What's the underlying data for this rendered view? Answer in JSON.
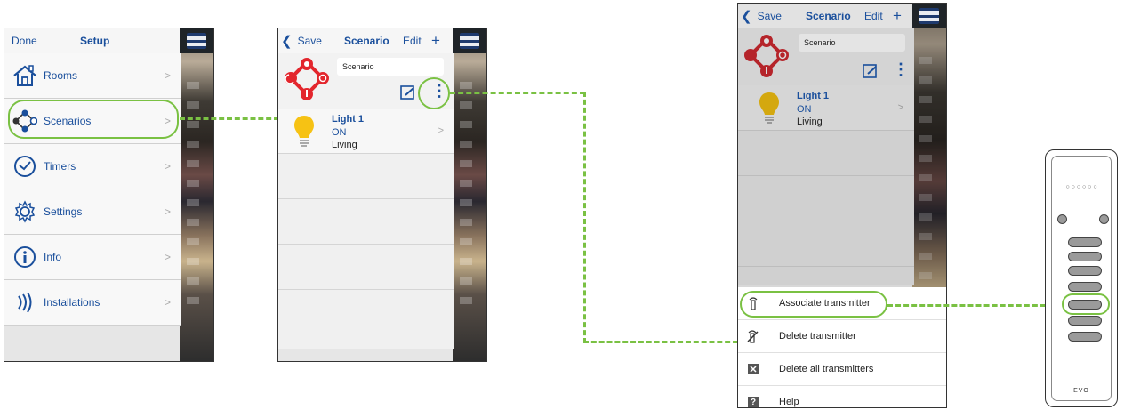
{
  "panel1": {
    "done_label": "Done",
    "title": "Setup",
    "items": [
      {
        "label": "Rooms",
        "icon": "house-icon"
      },
      {
        "label": "Scenarios",
        "icon": "scenario-icon"
      },
      {
        "label": "Timers",
        "icon": "clock-icon"
      },
      {
        "label": "Settings",
        "icon": "gear-icon"
      },
      {
        "label": "Info",
        "icon": "info-icon"
      },
      {
        "label": "Installations",
        "icon": "signal-icon"
      }
    ],
    "chevron": ">"
  },
  "panel2": {
    "save_label": "Save",
    "title": "Scenario",
    "edit_label": "Edit",
    "add_label": "+",
    "scenario_name": "Scenario",
    "device": {
      "name": "Light 1",
      "state": "ON",
      "room": "Living"
    },
    "chevron": ">"
  },
  "panel3": {
    "save_label": "Save",
    "title": "Scenario",
    "edit_label": "Edit",
    "add_label": "+",
    "scenario_name": "Scenario",
    "device": {
      "name": "Light 1",
      "state": "ON",
      "room": "Living"
    },
    "chevron": ">",
    "sheet_items": [
      {
        "label": "Associate transmitter",
        "icon": "remote-icon"
      },
      {
        "label": "Delete transmitter",
        "icon": "remote-delete-icon"
      },
      {
        "label": "Delete all transmitters",
        "icon": "delete-all-icon"
      },
      {
        "label": "Help",
        "icon": "help-icon"
      }
    ]
  },
  "remote": {
    "brand": "EVO",
    "dots": "○ ○ ○ ○ ○ ○"
  },
  "colors": {
    "highlight": "#7ac143",
    "brand_blue": "#1a4f9c",
    "scenario_red": "#e3262d",
    "bulb_yellow": "#f6c214"
  }
}
